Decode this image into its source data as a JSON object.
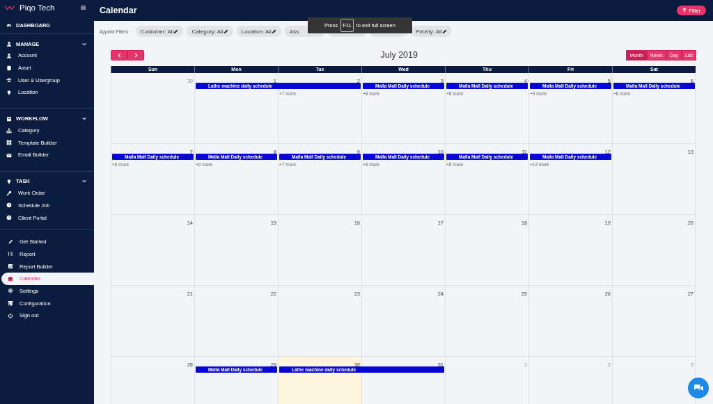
{
  "sidebar": {
    "brand": "Piqo Tech",
    "dashboard": "DASHBOARD",
    "sections": [
      {
        "title": "MANAGE",
        "expanded": true,
        "items": [
          {
            "label": "Account"
          },
          {
            "label": "Asset"
          },
          {
            "label": "User & Usergroup"
          },
          {
            "label": "Location"
          }
        ]
      },
      {
        "title": "WORKFLOW",
        "expanded": true,
        "items": [
          {
            "label": "Category"
          },
          {
            "label": "Template Builder"
          },
          {
            "label": "Email Builder"
          }
        ]
      },
      {
        "title": "TASK",
        "expanded": true,
        "items": [
          {
            "label": "Work Order"
          },
          {
            "label": "Schedule Job"
          },
          {
            "label": "Client Portal"
          }
        ]
      }
    ],
    "links": [
      {
        "label": "Get Started",
        "selected": false
      },
      {
        "label": "Report",
        "selected": false
      },
      {
        "label": "Report Builder",
        "selected": false
      },
      {
        "label": "Calender",
        "selected": true
      },
      {
        "label": "Settings",
        "selected": false
      },
      {
        "label": "Configuration",
        "selected": false
      },
      {
        "label": "Sign out",
        "selected": false
      }
    ]
  },
  "header": {
    "title": "Calendar",
    "filter_button": "Filter"
  },
  "toast": {
    "before": "Press",
    "key": "F11",
    "after": "to exit full screen"
  },
  "filters": {
    "label": "Applied Filters :",
    "chips": [
      {
        "text": "Customer: All",
        "covered": false
      },
      {
        "text": "Category: All",
        "covered": false
      },
      {
        "text": "Location: All",
        "covered": false
      },
      {
        "text": "Ass",
        "covered": true
      },
      {
        "covered": true
      },
      {
        "covered": true
      },
      {
        "text": "Priority: All",
        "covered": false
      }
    ]
  },
  "calendar": {
    "title": "July 2019",
    "views": [
      {
        "label": "Month",
        "selected": true
      },
      {
        "label": "Week",
        "selected": false
      },
      {
        "label": "Day",
        "selected": false
      },
      {
        "label": "List",
        "selected": false
      }
    ],
    "weekdays": [
      "Sun",
      "Mon",
      "Tue",
      "Wed",
      "Thu",
      "Fri",
      "Sat"
    ],
    "weeks": [
      {
        "days": [
          {
            "num": "30",
            "other_month": true,
            "today": false
          },
          {
            "num": "1",
            "other_month": false,
            "today": false,
            "event": "Lathe machine daily schedule"
          },
          {
            "num": "2",
            "other_month": false,
            "today": false,
            "continued": true,
            "more": "+7 more"
          },
          {
            "num": "3",
            "other_month": false,
            "today": false,
            "event": "Malla Mall Daily schedule",
            "more": "+8 more"
          },
          {
            "num": "4",
            "other_month": false,
            "today": false,
            "event": "Malla Mall Daily schedule",
            "more": "+8 more"
          },
          {
            "num": "5",
            "other_month": false,
            "today": false,
            "event": "Malla Mall Daily schedule",
            "more": "+9 more"
          },
          {
            "num": "6",
            "other_month": false,
            "today": false,
            "event": "Malla Mall Daily schedule",
            "more": "+6 more"
          }
        ]
      },
      {
        "days": [
          {
            "num": "7",
            "other_month": false,
            "today": false,
            "event": "Malla Mall Daily schedule",
            "more": "+6 more"
          },
          {
            "num": "8",
            "other_month": false,
            "today": false,
            "event": "Malla Mall Daily schedule",
            "more": "+6 more"
          },
          {
            "num": "9",
            "other_month": false,
            "today": false,
            "event": "Malla Mall Daily schedule",
            "more": "+7 more"
          },
          {
            "num": "10",
            "other_month": false,
            "today": false,
            "event": "Malla Mall Daily schedule",
            "more": "+8 more"
          },
          {
            "num": "11",
            "other_month": false,
            "today": false,
            "event": "Malla Mall Daily schedule",
            "more": "+8 more"
          },
          {
            "num": "12",
            "other_month": false,
            "today": false,
            "event": "Malla Mall Daily schedule",
            "more": "+14 more"
          },
          {
            "num": "13",
            "other_month": false,
            "today": false
          }
        ]
      },
      {
        "days": [
          {
            "num": "14",
            "other_month": false,
            "today": false
          },
          {
            "num": "15",
            "other_month": false,
            "today": false
          },
          {
            "num": "16",
            "other_month": false,
            "today": false
          },
          {
            "num": "17",
            "other_month": false,
            "today": false
          },
          {
            "num": "18",
            "other_month": false,
            "today": false
          },
          {
            "num": "19",
            "other_month": false,
            "today": false
          },
          {
            "num": "20",
            "other_month": false,
            "today": false
          }
        ]
      },
      {
        "days": [
          {
            "num": "21",
            "other_month": false,
            "today": false
          },
          {
            "num": "22",
            "other_month": false,
            "today": false
          },
          {
            "num": "23",
            "other_month": false,
            "today": false
          },
          {
            "num": "24",
            "other_month": false,
            "today": false
          },
          {
            "num": "25",
            "other_month": false,
            "today": false
          },
          {
            "num": "26",
            "other_month": false,
            "today": false
          },
          {
            "num": "27",
            "other_month": false,
            "today": false
          }
        ]
      },
      {
        "days": [
          {
            "num": "28",
            "other_month": false,
            "today": false
          },
          {
            "num": "29",
            "other_month": false,
            "today": false,
            "event": "Malla Mall Daily schedule"
          },
          {
            "num": "30",
            "other_month": false,
            "today": true,
            "event": "Lathe machine daily schedule"
          },
          {
            "num": "31",
            "other_month": false,
            "today": false,
            "continued": true
          },
          {
            "num": "1",
            "other_month": true,
            "today": false
          },
          {
            "num": "2",
            "other_month": true,
            "today": false
          },
          {
            "num": "3",
            "other_month": true,
            "today": false
          }
        ]
      }
    ]
  }
}
